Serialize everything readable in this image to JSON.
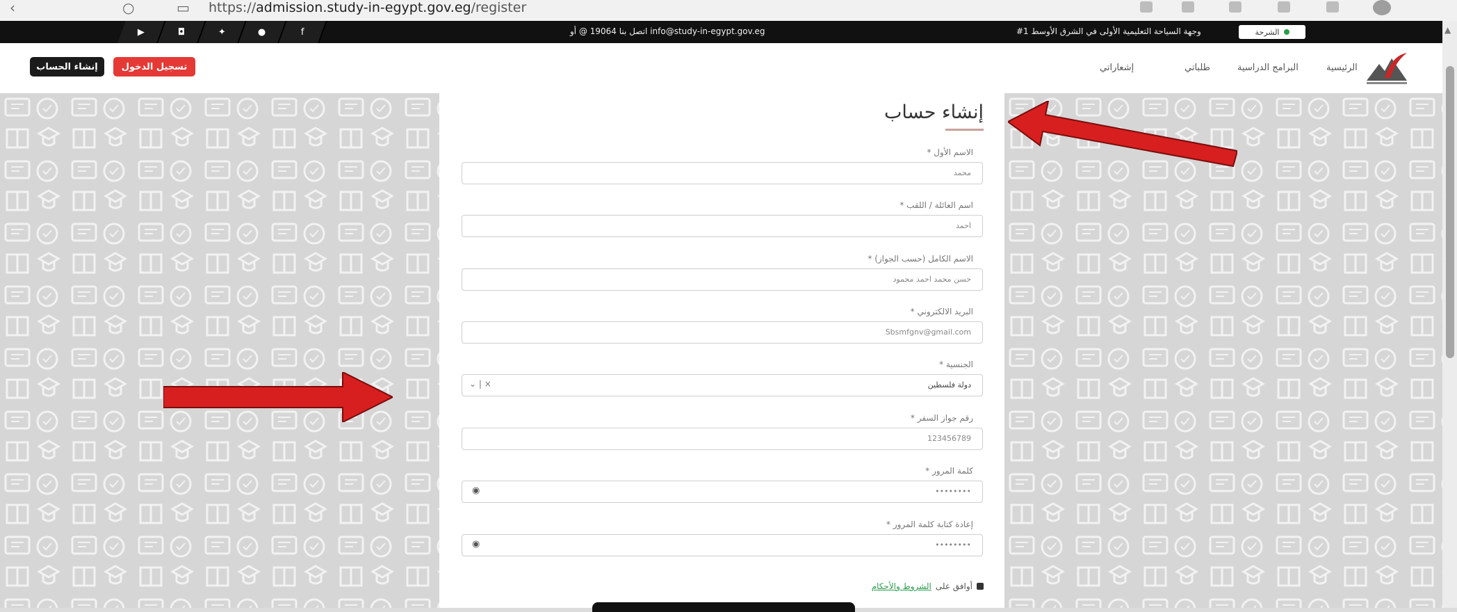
{
  "browser": {
    "url_prefix": "https://",
    "url_host": "admission.study-in-egypt.gov.eg",
    "url_path": "/register"
  },
  "topbar": {
    "social_icons": [
      "youtube-icon",
      "instagram-icon",
      "twitter-icon",
      "pinterest-icon",
      "facebook-icon"
    ],
    "contact": "اتصل بنا 19064 @ أو info@study-in-egypt.gov.eg",
    "tagline": "#1 وجهة السياحة التعليمية الأولى في الشرق الأوسط",
    "subscribe_label": "الشرحة"
  },
  "navbar": {
    "create_account": "إنشاء الحساب",
    "login": "تسجيل الدخول",
    "links": [
      "الرئيسية",
      "البرامج الدراسية",
      "طلباتي",
      "إشعاراتي"
    ]
  },
  "form": {
    "title": "إنشاء حساب",
    "fields": [
      {
        "label": "الاسم الأول *",
        "value": "محمد"
      },
      {
        "label": "اسم العائلة / اللقب *",
        "value": "احمد"
      },
      {
        "label": "الاسم الكامل (حسب الجواز) *",
        "value": "حسن محمد احمد محمود"
      },
      {
        "label": "البريد الالكتروني *",
        "value": "Sbsmfgnv@gmail.com"
      },
      {
        "label": "الجنسية *",
        "value": "دولة فلسطين"
      },
      {
        "label": "رقم جواز السفر *",
        "value": "123456789"
      },
      {
        "label": "كلمة المرور *",
        "value": "••••••••"
      },
      {
        "label": "إعادة كتابة كلمة المرور *",
        "value": "••••••••"
      }
    ],
    "terms_prefix": "أوافق على",
    "terms_link": "الشروط والأحكام"
  },
  "colors": {
    "accent_red": "#e53935",
    "dark": "#111111",
    "link_green": "#2a9d4a",
    "arrow_red": "#d81f1f"
  }
}
